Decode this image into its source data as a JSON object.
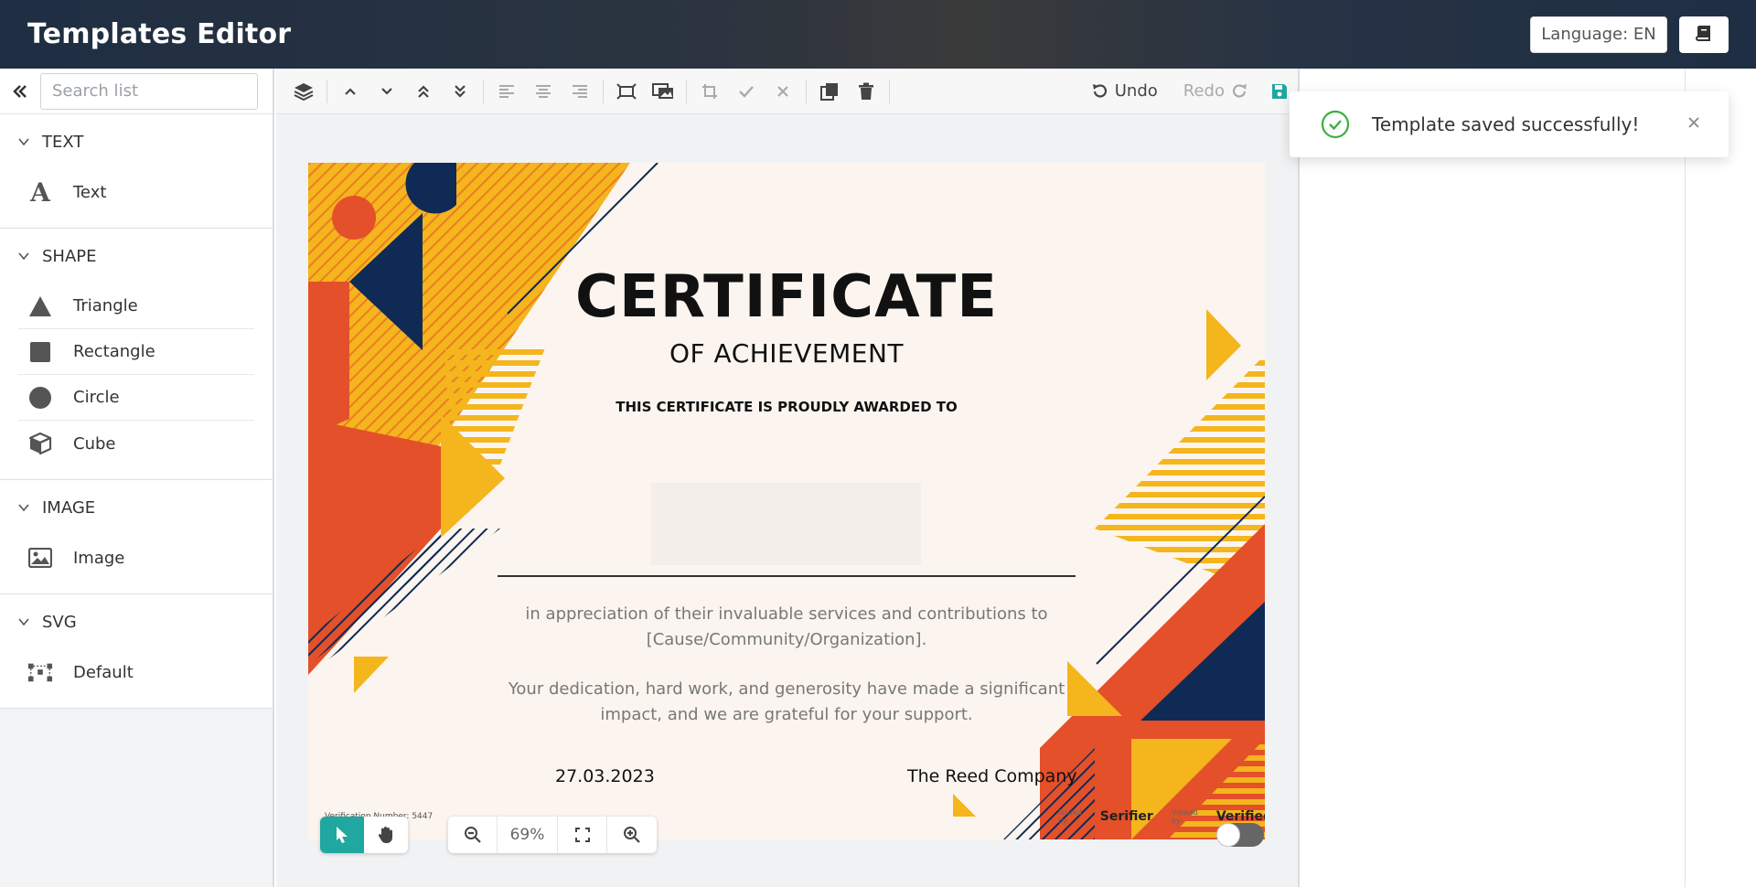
{
  "header": {
    "title": "Templates Editor",
    "language_label": "Language: EN",
    "docs_icon": "book-icon"
  },
  "sidebar": {
    "search_placeholder": "Search list",
    "sections": [
      {
        "title": "TEXT",
        "items": [
          {
            "label": "Text",
            "icon": "text-icon"
          }
        ]
      },
      {
        "title": "SHAPE",
        "items": [
          {
            "label": "Triangle",
            "icon": "triangle-icon"
          },
          {
            "label": "Rectangle",
            "icon": "rectangle-icon"
          },
          {
            "label": "Circle",
            "icon": "circle-icon"
          },
          {
            "label": "Cube",
            "icon": "cube-icon"
          }
        ]
      },
      {
        "title": "IMAGE",
        "items": [
          {
            "label": "Image",
            "icon": "image-icon"
          }
        ]
      },
      {
        "title": "SVG",
        "items": [
          {
            "label": "Default",
            "icon": "svg-nodes-icon"
          }
        ]
      }
    ]
  },
  "toolbar": {
    "undo_label": "Undo",
    "redo_label": "Redo"
  },
  "certificate": {
    "title": "CERTIFICATE",
    "subtitle": "OF ACHIEVEMENT",
    "awarded_to": "THIS CERTIFICATE IS PROUDLY AWARDED TO",
    "body_line1": "in appreciation of their invaluable services and contributions to",
    "body_line2": "[Cause/Community/Organization].",
    "body_line3": "Your dedication, hard work, and generosity have made a significant",
    "body_line4": "impact, and we are grateful for your support.",
    "date": "27.03.2023",
    "company": "The Reed Company",
    "verification": "Verification Number: 5447",
    "issued_by": "Issued by:",
    "issuer_logo": "Serifier",
    "viewed_by": "Viewed by:",
    "viewer_logo": "Verified"
  },
  "zoom": {
    "value": "69%"
  },
  "toast": {
    "message": "Template saved successfully!"
  },
  "colors": {
    "accent": "#1fa7a0",
    "cert_yellow": "#f4b51d",
    "cert_orange": "#e3502a",
    "cert_navy": "#0f2b55",
    "success": "#3cb043"
  }
}
